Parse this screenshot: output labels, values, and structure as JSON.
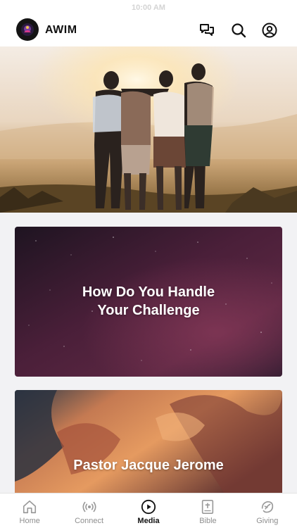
{
  "status_bar": {
    "time": "10:00 AM"
  },
  "header": {
    "app_name": "AWIM",
    "icons": [
      "chat-icon",
      "search-icon",
      "profile-icon"
    ]
  },
  "hero": {
    "image": "group-hugging-at-sunset"
  },
  "cards": [
    {
      "title": "How Do You Handle\nYour Challenge",
      "background": "purple-starry-night"
    },
    {
      "title": "Pastor Jacque Jerome",
      "background": "orange-sunset-clouds"
    }
  ],
  "tabs": [
    {
      "label": "Home",
      "icon": "home-icon",
      "active": false
    },
    {
      "label": "Connect",
      "icon": "broadcast-icon",
      "active": false
    },
    {
      "label": "Media",
      "icon": "play-icon",
      "active": true
    },
    {
      "label": "Bible",
      "icon": "bible-icon",
      "active": false
    },
    {
      "label": "Giving",
      "icon": "giving-icon",
      "active": false
    }
  ],
  "colors": {
    "active_tab": "#111111",
    "inactive_tab": "#8e8e8e",
    "background": "#f2f2f4"
  }
}
